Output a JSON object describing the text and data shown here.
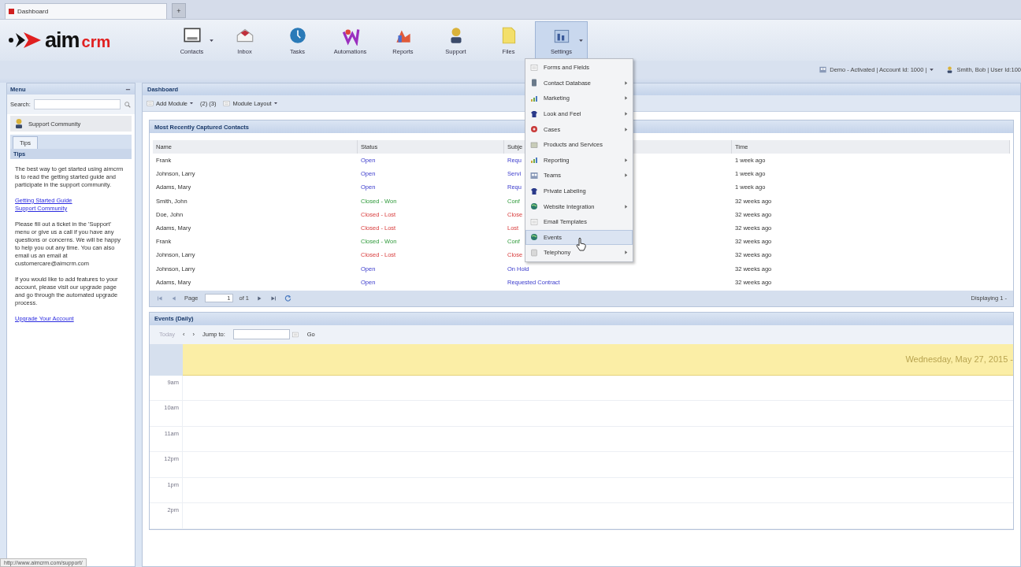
{
  "browser_tab": {
    "title": "Dashboard",
    "new_tab": "+"
  },
  "logo": {
    "left": "aim",
    "right": "crm"
  },
  "toolbar": [
    {
      "label": "Contacts",
      "dropdown": true,
      "selected": false
    },
    {
      "label": "Inbox",
      "dropdown": false,
      "selected": false
    },
    {
      "label": "Tasks",
      "dropdown": false,
      "selected": false
    },
    {
      "label": "Automations",
      "dropdown": false,
      "selected": false
    },
    {
      "label": "Reports",
      "dropdown": false,
      "selected": false
    },
    {
      "label": "Support",
      "dropdown": false,
      "selected": false
    },
    {
      "label": "Files",
      "dropdown": false,
      "selected": false
    },
    {
      "label": "Settings",
      "dropdown": true,
      "selected": true
    }
  ],
  "account_bar": {
    "account": "Demo - Activated | Account Id: 1000 |",
    "user": "Smith, Bob | User Id:100"
  },
  "sidebar": {
    "title": "Menu",
    "search_label": "Search:",
    "community": "Support Community",
    "tabs": [
      {
        "label": "Tips",
        "selected": true
      }
    ],
    "section": "Tips",
    "paragraphs": [
      {
        "kind": "text",
        "text": "The best way to get started using aimcrm is to read the getting started guide and participate in the support community."
      },
      {
        "kind": "links",
        "links": [
          "Getting Started Guide",
          "Support Community"
        ]
      },
      {
        "kind": "text",
        "text": "Please fill out a ticket in the 'Support' menu or give us a call if you have any questions or concerns. We will be happy to help you out any time. You can also email us an email at customercare@aimcrm.com"
      },
      {
        "kind": "text",
        "text": "If you would like to add features to your account, please visit our upgrade page and go through the automated upgrade process."
      },
      {
        "kind": "links",
        "links": [
          "Upgrade Your Account"
        ]
      }
    ]
  },
  "dashboard": {
    "title": "Dashboard",
    "toolbar": [
      {
        "label": "Add Module",
        "dropdown": true
      },
      {
        "label": "(2) (3)",
        "dropdown": false
      },
      {
        "label": "Module Layout",
        "dropdown": true
      }
    ]
  },
  "contacts_panel": {
    "title": "Most Recently Captured Contacts",
    "columns": [
      "Name",
      "Status",
      "Subje",
      "Time"
    ],
    "rows": [
      {
        "name": "Frank",
        "status": "Open",
        "kind": "open",
        "subject": "Requ",
        "time": "1 week ago"
      },
      {
        "name": "Johnson, Larry",
        "status": "Open",
        "kind": "open",
        "subject": "Servi",
        "time": "1 week ago"
      },
      {
        "name": "Adams, Mary",
        "status": "Open",
        "kind": "open",
        "subject": "Requ",
        "time": "1 week ago"
      },
      {
        "name": "Smith, John",
        "status": "Closed - Won",
        "kind": "won",
        "subject": "Conf",
        "time": "32 weeks ago"
      },
      {
        "name": "Doe, John",
        "status": "Closed - Lost",
        "kind": "lost",
        "subject": "Close",
        "time": "32 weeks ago"
      },
      {
        "name": "Adams, Mary",
        "status": "Closed - Lost",
        "kind": "lost",
        "subject": "Lost",
        "time": "32 weeks ago"
      },
      {
        "name": "Frank",
        "status": "Closed - Won",
        "kind": "won",
        "subject": "Conf",
        "time": "32 weeks ago"
      },
      {
        "name": "Johnson, Larry",
        "status": "Closed - Lost",
        "kind": "lost",
        "subject": "Close",
        "time": "32 weeks ago"
      },
      {
        "name": "Johnson, Larry",
        "status": "Open",
        "kind": "open",
        "subject": "On Hold",
        "time": "32 weeks ago"
      },
      {
        "name": "Adams, Mary",
        "status": "Open",
        "kind": "open",
        "subject": "Requested Contract",
        "time": "32 weeks ago"
      }
    ],
    "pager": {
      "page_label": "Page",
      "page": "1",
      "of": "of 1",
      "displaying": "Displaying 1 -"
    }
  },
  "events_panel": {
    "title": "Events (Daily)",
    "today": "Today",
    "prev": "‹",
    "next": "›",
    "jump_label": "Jump to:",
    "go": "Go",
    "date": "Wednesday, May 27, 2015 -",
    "times": [
      "9am",
      "10am",
      "11am",
      "12pm",
      "1pm",
      "2pm"
    ]
  },
  "settings_menu": {
    "items": [
      {
        "label": "Forms and Fields",
        "submenu": false,
        "selected": false
      },
      {
        "label": "Contact Database",
        "submenu": true,
        "selected": false
      },
      {
        "label": "Marketing",
        "submenu": true,
        "selected": false
      },
      {
        "label": "Look and Feel",
        "submenu": true,
        "selected": false
      },
      {
        "label": "Cases",
        "submenu": true,
        "selected": false
      },
      {
        "label": "Products and Services",
        "submenu": false,
        "selected": false
      },
      {
        "label": "Reporting",
        "submenu": true,
        "selected": false
      },
      {
        "label": "Teams",
        "submenu": true,
        "selected": false
      },
      {
        "label": "Private Labeling",
        "submenu": false,
        "selected": false
      },
      {
        "label": "Website Integration",
        "submenu": true,
        "selected": false
      },
      {
        "label": "Email Templates",
        "submenu": false,
        "selected": false
      },
      {
        "label": "Events",
        "submenu": false,
        "selected": true
      },
      {
        "label": "Telephony",
        "submenu": true,
        "selected": false
      }
    ]
  },
  "status_bar": {
    "url": "http://www.aimcrm.com/support/"
  }
}
